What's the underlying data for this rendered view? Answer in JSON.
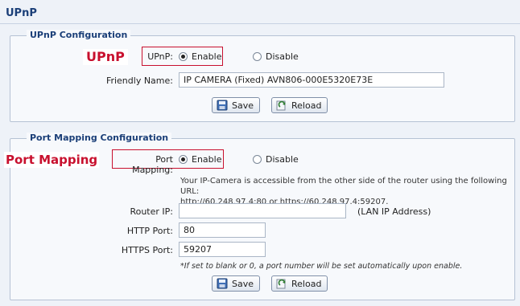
{
  "page": {
    "title": "UPnP"
  },
  "upnp_config": {
    "legend": "UPnP Configuration",
    "callout": "UPnP",
    "upnp_label": "UPnP:",
    "enable_label": "Enable",
    "disable_label": "Disable",
    "selected": "enable",
    "friendly_name_label": "Friendly Name:",
    "friendly_name_value": "IP CAMERA (Fixed) AVN806-000E5320E73E",
    "save_label": "Save",
    "reload_label": "Reload"
  },
  "port_mapping": {
    "legend": "Port Mapping Configuration",
    "callout": "Port Mapping",
    "port_mapping_label": "Port Mapping:",
    "enable_label": "Enable",
    "disable_label": "Disable",
    "selected": "enable",
    "info_line1": "Your IP-Camera is accessible from the other side of the router using the following URL:",
    "info_line2": "http://60.248.97.4:80 or https://60.248.97.4:59207.",
    "router_ip_label": "Router IP:",
    "router_ip_value": "",
    "router_ip_hint": "(LAN IP Address)",
    "http_port_label": "HTTP Port:",
    "http_port_value": "80",
    "https_port_label": "HTTPS Port:",
    "https_port_value": "59207",
    "hint": "*If set to blank or 0, a port number will be set automatically upon enable.",
    "save_label": "Save",
    "reload_label": "Reload"
  },
  "icons": {
    "save": "save-icon",
    "reload": "reload-icon",
    "radio": "radio-icon"
  },
  "colors": {
    "accent": "#c8102e",
    "title": "#1b3f78"
  }
}
